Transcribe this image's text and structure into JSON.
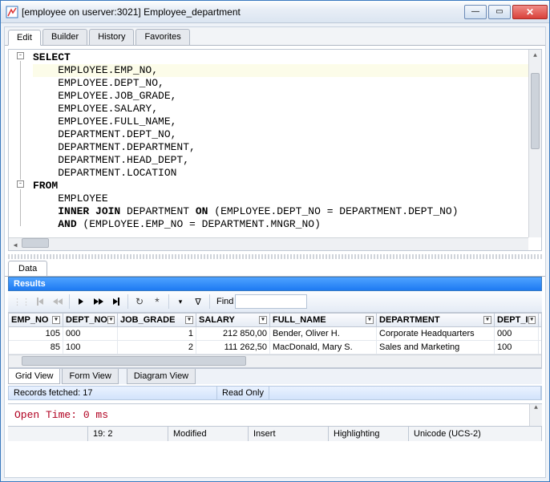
{
  "titlebar": {
    "text": "[employee on userver:3021] Employee_department"
  },
  "tabs": {
    "edit": "Edit",
    "builder": "Builder",
    "history": "History",
    "favorites": "Favorites"
  },
  "sql": {
    "l0": "SELECT",
    "l1": "    EMPLOYEE.EMP_NO,",
    "l2": "    EMPLOYEE.DEPT_NO,",
    "l3": "    EMPLOYEE.JOB_GRADE,",
    "l4": "    EMPLOYEE.SALARY,",
    "l5": "    EMPLOYEE.FULL_NAME,",
    "l6": "    DEPARTMENT.DEPT_NO,",
    "l7": "    DEPARTMENT.DEPARTMENT,",
    "l8": "    DEPARTMENT.HEAD_DEPT,",
    "l9": "    DEPARTMENT.LOCATION",
    "l10": "FROM",
    "l11": "    EMPLOYEE",
    "l12_a": "    ",
    "l12_kw": "INNER JOIN",
    "l12_b": " DEPARTMENT ",
    "l12_on": "ON",
    "l12_c": " (EMPLOYEE.DEPT_NO = DEPARTMENT.DEPT_NO)",
    "l13_a": "    ",
    "l13_kw": "AND",
    "l13_b": " (EMPLOYEE.EMP_NO = DEPARTMENT.MNGR_NO)"
  },
  "data_tab": "Data",
  "results_label": "Results",
  "toolbar_find": "Find",
  "icons": {
    "refresh": "↻",
    "star": "*",
    "funnel_check": "▾",
    "funnel": "∇"
  },
  "grid": {
    "headers": [
      "EMP_NO",
      "DEPT_NO",
      "JOB_GRADE",
      "SALARY",
      "FULL_NAME",
      "DEPARTMENT",
      "DEPT_I"
    ],
    "rows": [
      {
        "emp_no": "105",
        "dept_no": "000",
        "job_grade": "1",
        "salary": "212 850,00",
        "full_name": "Bender, Oliver H.",
        "department": "Corporate Headquarters",
        "dept_i": "000"
      },
      {
        "emp_no": "85",
        "dept_no": "100",
        "job_grade": "2",
        "salary": "111 262,50",
        "full_name": "MacDonald, Mary S.",
        "department": "Sales and Marketing",
        "dept_i": "100"
      }
    ]
  },
  "views": {
    "grid": "Grid View",
    "form": "Form View",
    "diagram": "Diagram View"
  },
  "fetch": {
    "records": "Records fetched: 17",
    "readonly": "Read Only"
  },
  "open_time": "Open Time: 0 ms",
  "status": {
    "pos": "19:  2",
    "modified": "Modified",
    "insert": "Insert",
    "highlighting": "Highlighting",
    "encoding": "Unicode (UCS-2)"
  }
}
